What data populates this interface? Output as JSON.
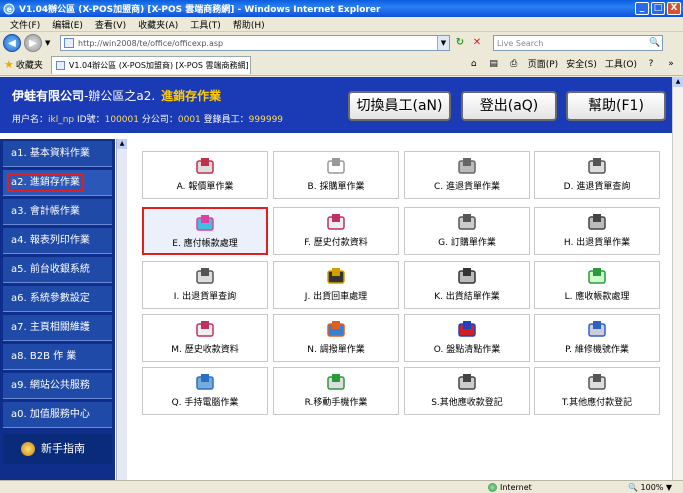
{
  "window": {
    "title": "V1.04辦公區 (X-POS加盟商) [X-POS 雲端商務網] - Windows Internet Explorer",
    "minimize": "_",
    "maximize": "□",
    "close": "X"
  },
  "menu": [
    "文件(F)",
    "编辑(E)",
    "查看(V)",
    "收藏夹(A)",
    "工具(T)",
    "帮助(H)"
  ],
  "address": {
    "url": "http://win2008/te/office/officexp.asp",
    "search_placeholder": "Live Search"
  },
  "favorites": {
    "label": "收藏夹"
  },
  "tab": {
    "title": "V1.04辦公區 (X-POS加盟商) [X-POS 雲端商務網]"
  },
  "browser_toolbar": {
    "page": "页面(P)",
    "safety": "安全(S)",
    "tools": "工具(O)"
  },
  "header": {
    "company": "伊蛙有限公司",
    "office": "-辦公區之a2.",
    "module": "進銷存作業",
    "user_label": "用户名：",
    "user_value": "ikl_np",
    "id_label": "ID號：",
    "id_value": "100001",
    "branch_label": "分公司：",
    "branch_value": "0001",
    "staff_label": "登錄員工：",
    "staff_value": "999999",
    "buttons": {
      "switch": "切換員工(aN)",
      "logout": "登出(aQ)",
      "help": "幫助(F1)"
    }
  },
  "sidebar": {
    "items": [
      {
        "label": "a1. 基本資料作業"
      },
      {
        "label": "a2. 進銷存作業"
      },
      {
        "label": "a3. 會計帳作業"
      },
      {
        "label": "a4. 報表列印作業"
      },
      {
        "label": "a5. 前台收銀系統"
      },
      {
        "label": "a6. 系統參數設定"
      },
      {
        "label": "a7. 主頁相關維護"
      },
      {
        "label": "a8. B2B 作 業"
      },
      {
        "label": "a9. 網站公共服務"
      },
      {
        "label": "a0. 加值服務中心"
      }
    ],
    "guide": "新手指南"
  },
  "functions": [
    {
      "label": "A. 報價單作業",
      "icon": "printer-icon"
    },
    {
      "label": "B. 採購單作業",
      "icon": "pencil-paper-icon"
    },
    {
      "label": "C. 進退貨單作業",
      "icon": "box-icon"
    },
    {
      "label": "D. 進退貨單查詢",
      "icon": "magnifier-icon"
    },
    {
      "label": "E. 應付帳款處理",
      "icon": "colorful-grid-icon"
    },
    {
      "label": "F. 歷史付款資料",
      "icon": "magnifier-doc-icon"
    },
    {
      "label": "G. 訂購單作業",
      "icon": "book-icon"
    },
    {
      "label": "H. 出退貨單作業",
      "icon": "truck-icon"
    },
    {
      "label": "I. 出退貨單查詢",
      "icon": "magnifier-icon"
    },
    {
      "label": "J. 出貨回車處理",
      "icon": "forklift-icon"
    },
    {
      "label": "K. 出貨結單作業",
      "icon": "stamp-icon"
    },
    {
      "label": "L. 應收帳款處理",
      "icon": "money-icon"
    },
    {
      "label": "M. 歷史收款資料",
      "icon": "magnifier-doc-icon"
    },
    {
      "label": "N. 調撥單作業",
      "icon": "transfer-icon"
    },
    {
      "label": "O. 盤點清點作業",
      "icon": "inventory-icon"
    },
    {
      "label": "P. 維修機號作業",
      "icon": "repair-icon"
    },
    {
      "label": "Q. 手持電腦作業",
      "icon": "computer-icon"
    },
    {
      "label": "R.移動手機作業",
      "icon": "mobile-icon"
    },
    {
      "label": "S.其他應收款登記",
      "icon": "register-icon"
    },
    {
      "label": "T.其他應付款登記",
      "icon": "cash-register-icon"
    }
  ],
  "selected_function": 4,
  "status": {
    "zone": "Internet",
    "zoom": "100%"
  }
}
